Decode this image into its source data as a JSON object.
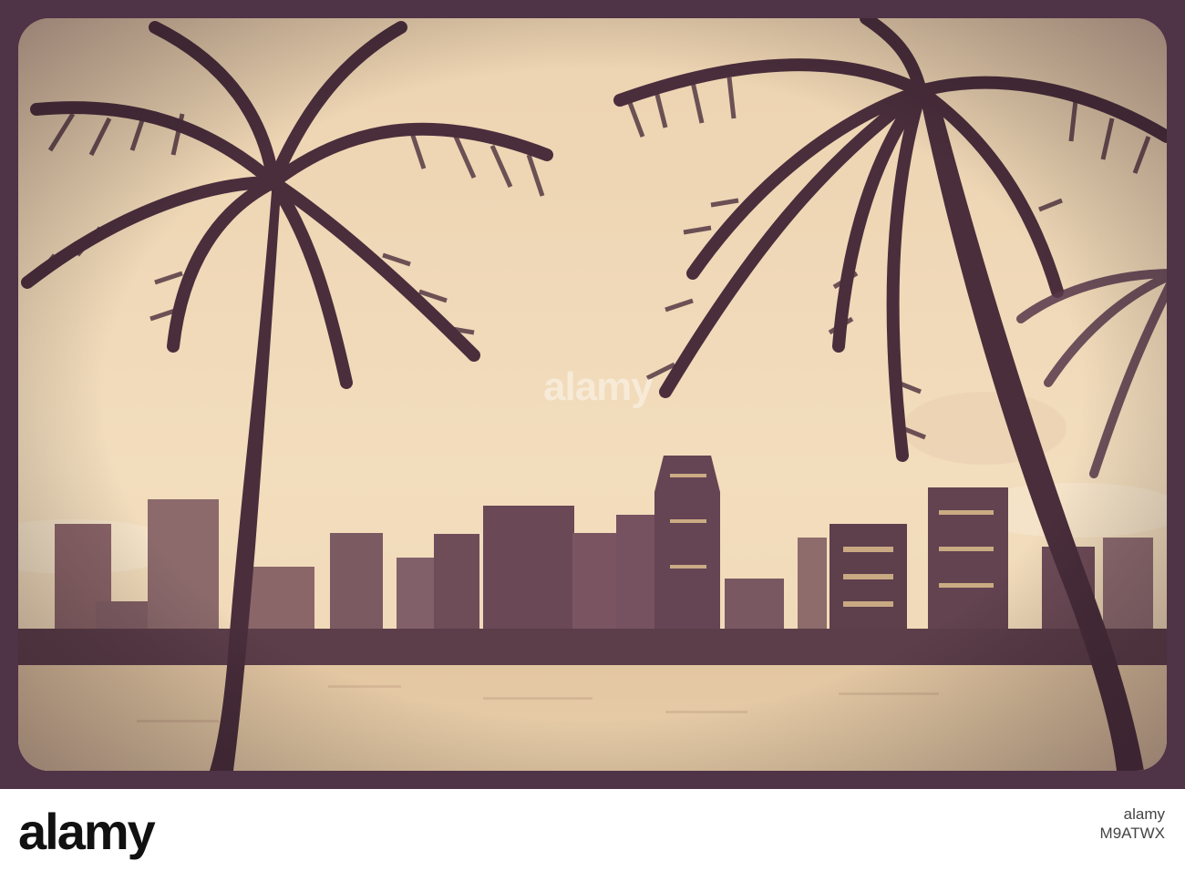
{
  "photo": {
    "subject": "palm-trees-and-city-skyline-at-dusk",
    "colors": {
      "frame": "#4f3346",
      "sky": "#f1dcbc",
      "water": "#ead1ad",
      "silhouette": "#4a2e3c"
    },
    "watermark_text": "alamy"
  },
  "footer": {
    "logo_text": "alamy",
    "brand_text": "alamy",
    "image_id": "M9ATWX"
  }
}
